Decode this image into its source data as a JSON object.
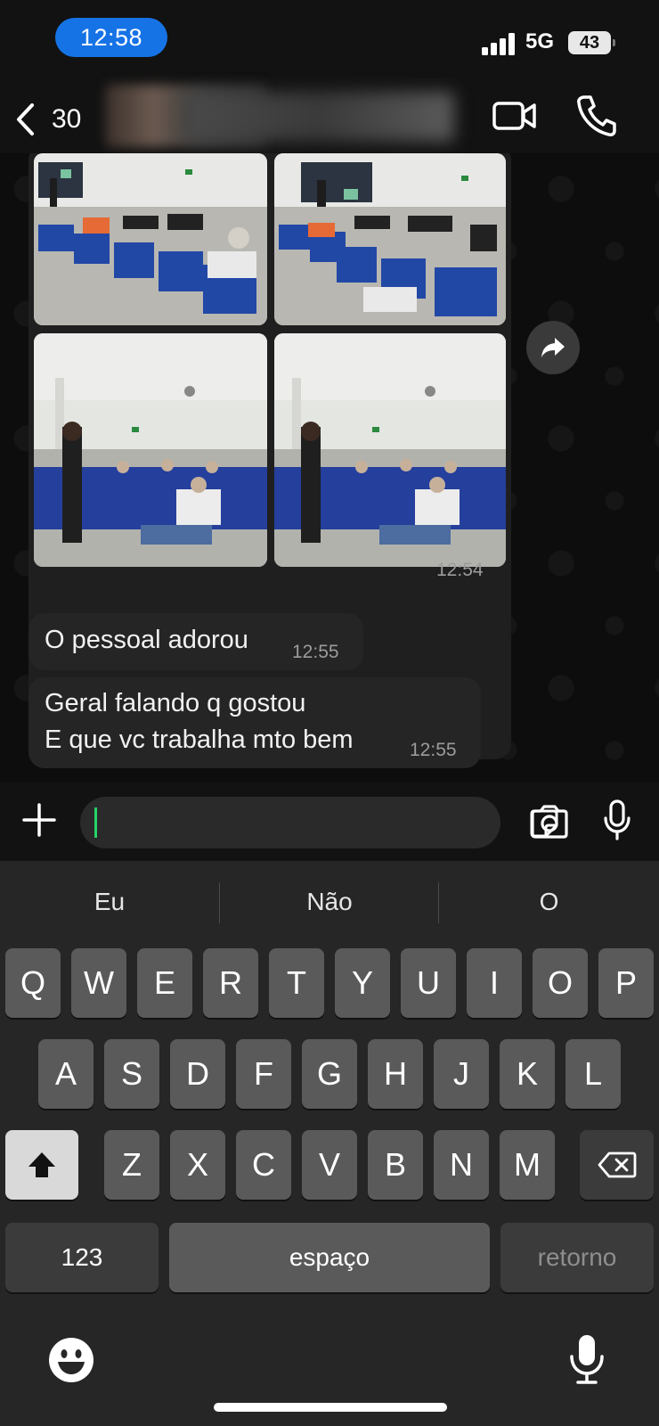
{
  "status_bar": {
    "time": "12:58",
    "network": "5G",
    "battery": "43"
  },
  "header": {
    "back_count": "30"
  },
  "messages": {
    "media_time": "12:54",
    "msg1": {
      "text": "O pessoal adorou",
      "time": "12:55"
    },
    "msg2": {
      "line1": "Geral falando q gostou",
      "line2": "E que vc trabalha mto bem",
      "time": "12:55"
    }
  },
  "keyboard": {
    "suggestions": [
      "Eu",
      "Não",
      "O"
    ],
    "row1": [
      "Q",
      "W",
      "E",
      "R",
      "T",
      "Y",
      "U",
      "I",
      "O",
      "P"
    ],
    "row2": [
      "A",
      "S",
      "D",
      "F",
      "G",
      "H",
      "J",
      "K",
      "L"
    ],
    "row3": [
      "Z",
      "X",
      "C",
      "V",
      "B",
      "N",
      "M"
    ],
    "numbers_label": "123",
    "space_label": "espaço",
    "return_label": "retorno"
  },
  "colors": {
    "accent": "#1673e6",
    "caret": "#25d366",
    "bubble": "#252525"
  },
  "icons": [
    "chevron-left-icon",
    "video-icon",
    "phone-icon",
    "forward-icon",
    "plus-icon",
    "sticker-icon",
    "camera-icon",
    "mic-icon",
    "shift-icon",
    "backspace-icon",
    "emoji-icon",
    "dictation-icon"
  ]
}
